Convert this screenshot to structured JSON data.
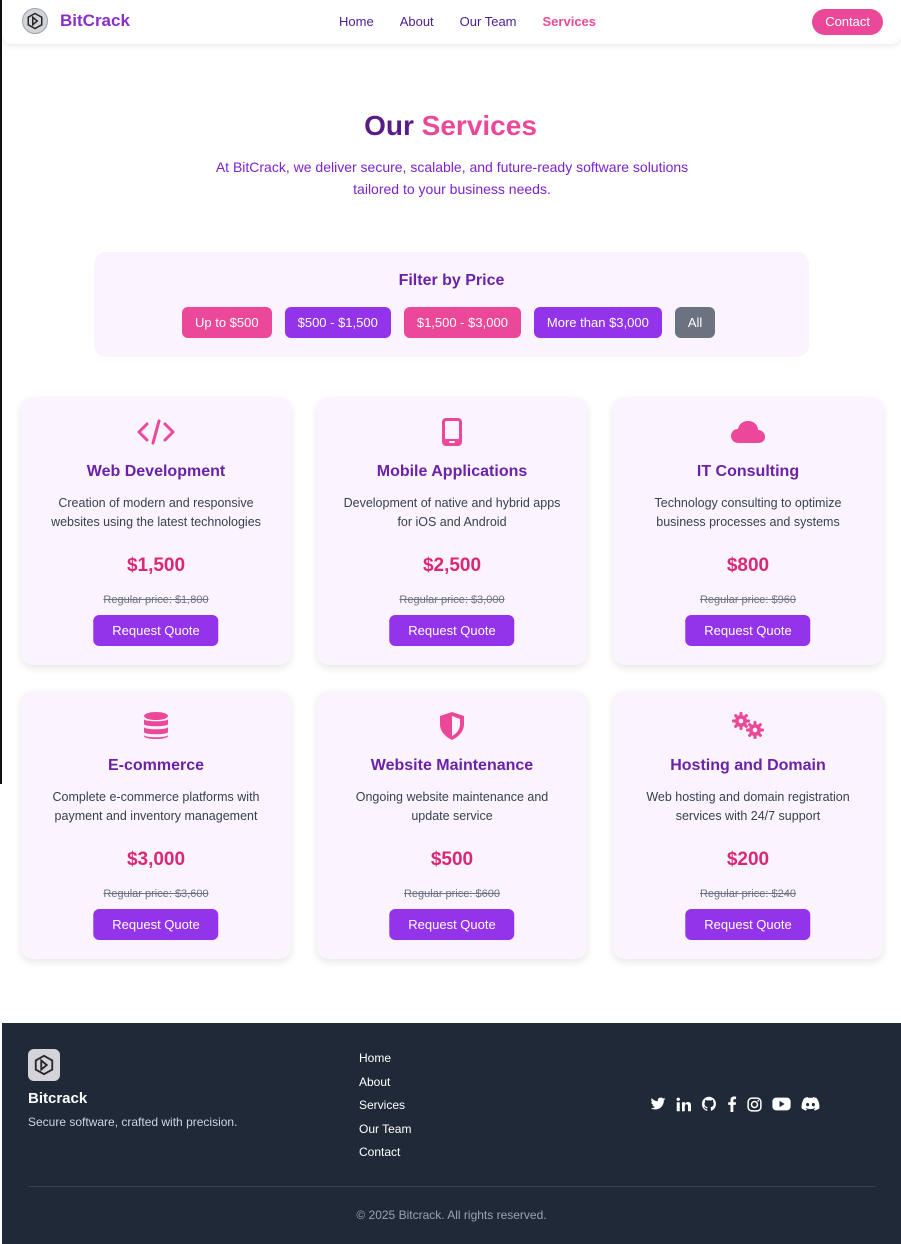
{
  "brand": {
    "name": "BitCrack",
    "logo_icon": "hexagon-logo-icon"
  },
  "nav": {
    "items": [
      {
        "label": "Home"
      },
      {
        "label": "About"
      },
      {
        "label": "Our Team"
      },
      {
        "label": "Services",
        "active": true
      }
    ],
    "contact_label": "Contact"
  },
  "hero": {
    "title_part1": "Our",
    "title_part2": "Services",
    "subtitle": "At BitCrack, we deliver secure, scalable, and future-ready software solutions tailored to your business needs."
  },
  "filter": {
    "title": "Filter by Price",
    "buttons": [
      {
        "label": "Up to $500",
        "color": "#ec4899"
      },
      {
        "label": "$500 - $1,500",
        "color": "#9333ea"
      },
      {
        "label": "$1,500 - $3,000",
        "color": "#ec4899"
      },
      {
        "label": "More than $3,000",
        "color": "#9333ea"
      },
      {
        "label": "All",
        "color": "#6b7280"
      }
    ]
  },
  "services": [
    {
      "icon": "code-icon",
      "title": "Web Development",
      "desc": "Creation of modern and responsive websites using the latest technologies",
      "price": "$1,500",
      "regular": "Regular price: $1,800",
      "cta": "Request Quote"
    },
    {
      "icon": "mobile-icon",
      "title": "Mobile Applications",
      "desc": "Development of native and hybrid apps for iOS and Android",
      "price": "$2,500",
      "regular": "Regular price: $3,000",
      "cta": "Request Quote"
    },
    {
      "icon": "cloud-icon",
      "title": "IT Consulting",
      "desc": "Technology consulting to optimize business processes and systems",
      "price": "$800",
      "regular": "Regular price: $960",
      "cta": "Request Quote"
    },
    {
      "icon": "database-icon",
      "title": "E-commerce",
      "desc": "Complete e-commerce platforms with payment and inventory management",
      "price": "$3,000",
      "regular": "Regular price: $3,600",
      "cta": "Request Quote"
    },
    {
      "icon": "shield-icon",
      "title": "Website Maintenance",
      "desc": "Ongoing website maintenance and update service",
      "price": "$500",
      "regular": "Regular price: $600",
      "cta": "Request Quote"
    },
    {
      "icon": "gears-icon",
      "title": "Hosting and Domain",
      "desc": "Web hosting and domain registration services with 24/7 support",
      "price": "$200",
      "regular": "Regular price: $240",
      "cta": "Request Quote"
    }
  ],
  "footer": {
    "brand": "Bitcrack",
    "tagline": "Secure software, crafted with precision.",
    "links": [
      {
        "label": "Home"
      },
      {
        "label": "About"
      },
      {
        "label": "Services"
      },
      {
        "label": "Our Team"
      },
      {
        "label": "Contact"
      }
    ],
    "social": [
      "twitter-icon",
      "linkedin-icon",
      "github-icon",
      "facebook-icon",
      "instagram-icon",
      "youtube-icon",
      "discord-icon"
    ],
    "copyright": "© 2025 Bitcrack. All rights reserved."
  },
  "colors": {
    "accent_pink": "#ec4899",
    "accent_purple": "#9333ea",
    "heading_purple": "#6b21a8",
    "footer_bg": "#1f2937"
  }
}
